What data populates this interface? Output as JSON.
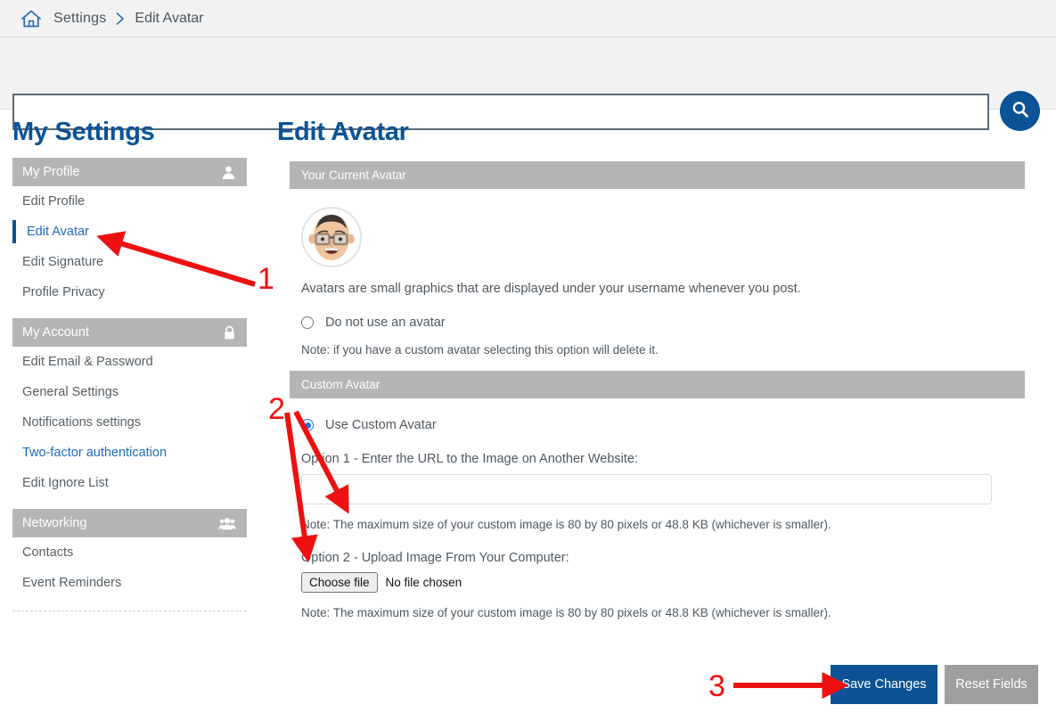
{
  "breadcrumb": {
    "home_icon": "home-icon",
    "parent": "Settings",
    "separator": "›",
    "current": "Edit Avatar"
  },
  "search": {
    "value": "",
    "placeholder": "",
    "button_icon": "search-icon"
  },
  "sidebar": {
    "title": "My Settings",
    "groups": [
      {
        "label": "My Profile",
        "icon": "user-icon",
        "items": [
          {
            "label": "Edit Profile",
            "state": "default"
          },
          {
            "label": "Edit Avatar",
            "state": "active"
          },
          {
            "label": "Edit Signature",
            "state": "default"
          },
          {
            "label": "Profile Privacy",
            "state": "default"
          }
        ]
      },
      {
        "label": "My Account",
        "icon": "lock-icon",
        "items": [
          {
            "label": "Edit Email & Password",
            "state": "default"
          },
          {
            "label": "General Settings",
            "state": "default"
          },
          {
            "label": "Notifications settings",
            "state": "default"
          },
          {
            "label": "Two-factor authentication",
            "state": "link"
          },
          {
            "label": "Edit Ignore List",
            "state": "default"
          }
        ]
      },
      {
        "label": "Networking",
        "icon": "users-icon",
        "items": [
          {
            "label": "Contacts",
            "state": "default"
          },
          {
            "label": "Event Reminders",
            "state": "default"
          }
        ]
      }
    ]
  },
  "main": {
    "title": "Edit Avatar",
    "current_avatar": {
      "header": "Your Current Avatar",
      "avatar_icon": "memoji-avatar",
      "description": "Avatars are small graphics that are displayed under your username whenever you post.",
      "no_avatar_option": {
        "label": "Do not use an avatar",
        "checked": false
      },
      "note": "Note: if you have a custom avatar selecting this option will delete it."
    },
    "custom_avatar": {
      "header": "Custom Avatar",
      "use_custom_option": {
        "label": "Use Custom Avatar",
        "checked": true
      },
      "option1_label": "Option 1 - Enter the URL to the Image on Another Website:",
      "url_value": "",
      "url_placeholder": "",
      "option1_note": "Note: The maximum size of your custom image is 80 by 80 pixels or 48.8 KB (whichever is smaller).",
      "option2_label": "Option 2 - Upload Image From Your Computer:",
      "choose_file_label": "Choose file",
      "file_status": "No file chosen",
      "option2_note": "Note: The maximum size of your custom image is 80 by 80 pixels or 48.8 KB (whichever is smaller)."
    }
  },
  "footer": {
    "save_label": "Save Changes",
    "reset_label": "Reset Fields"
  },
  "annotations": {
    "one": "1",
    "two": "2",
    "three": "3",
    "color": "#ee1111"
  },
  "colors": {
    "brand_blue": "#0b5394",
    "link_blue": "#1d6cc0",
    "header_gray": "#b5b5b5",
    "chrome_gray": "#f2f2f2",
    "reset_gray": "#9e9e9e",
    "annotation_red": "#ee1111"
  }
}
